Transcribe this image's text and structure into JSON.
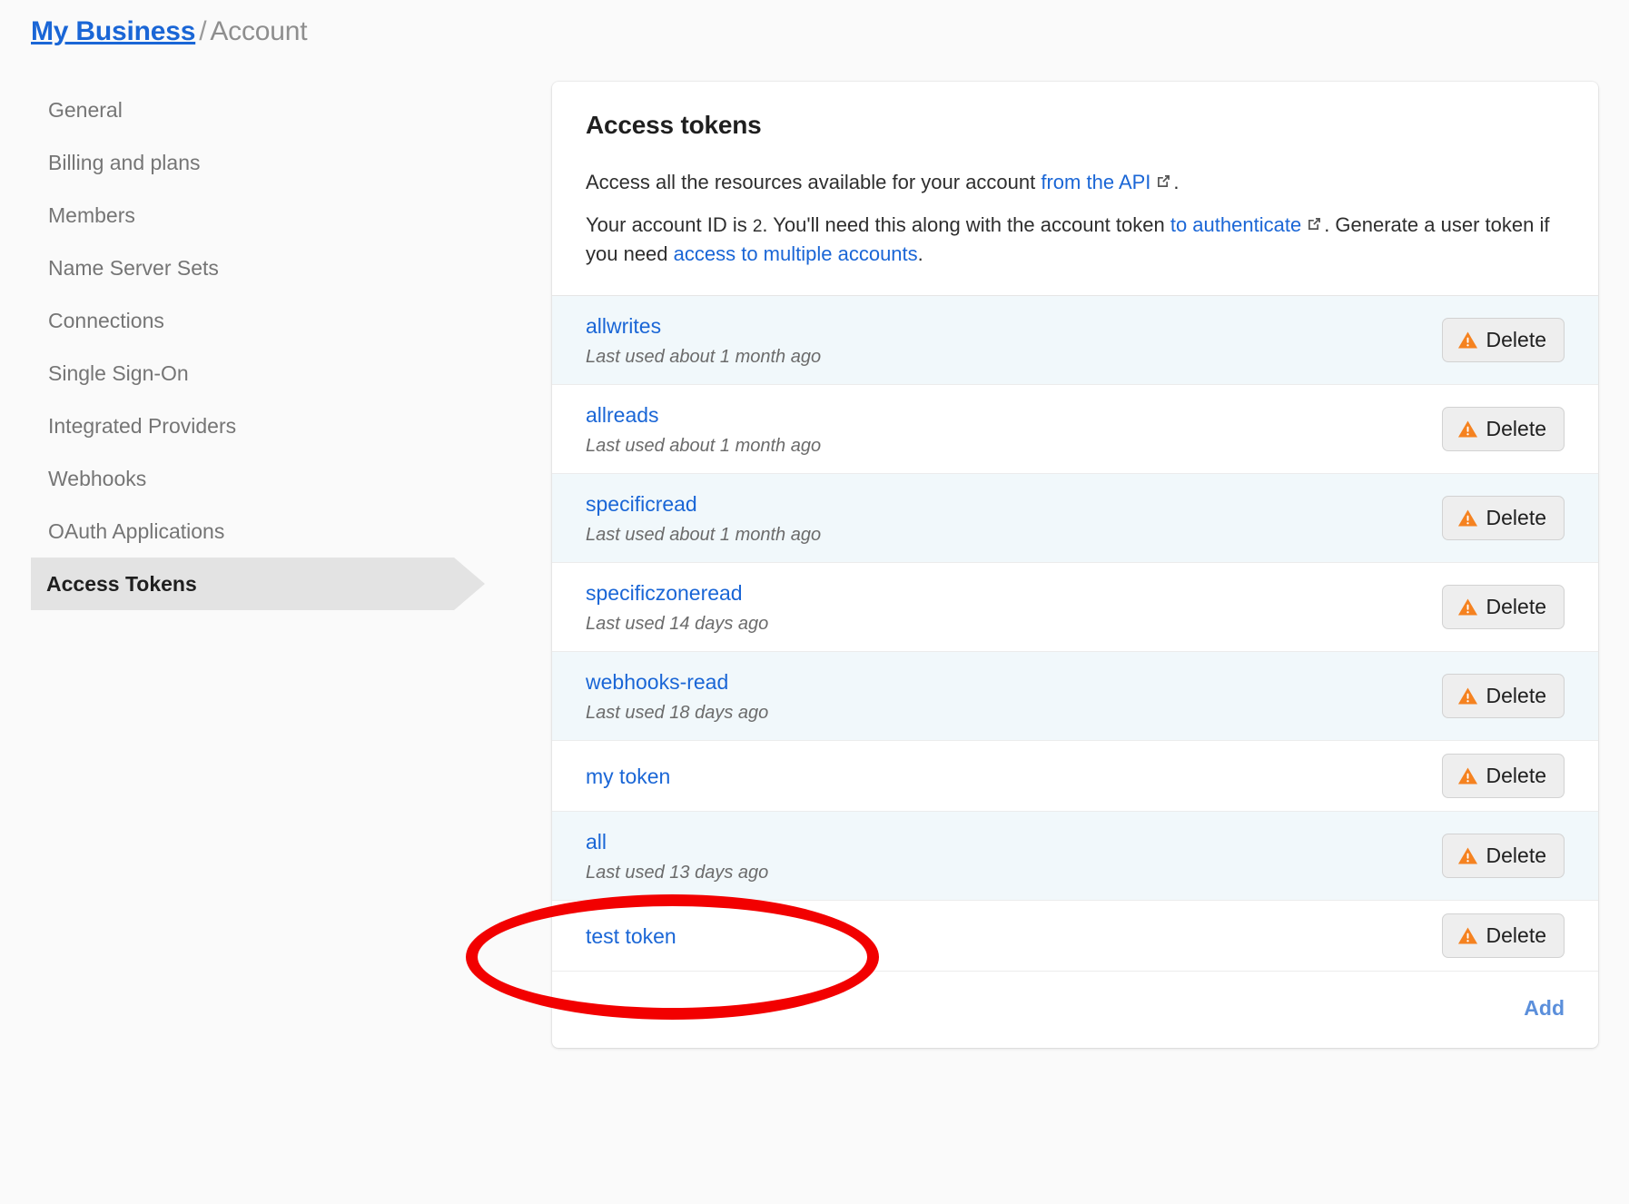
{
  "breadcrumb": {
    "root": "My Business",
    "separator": "/",
    "current": "Account"
  },
  "sidebar": {
    "items": [
      {
        "label": "General",
        "active": false
      },
      {
        "label": "Billing and plans",
        "active": false
      },
      {
        "label": "Members",
        "active": false
      },
      {
        "label": "Name Server Sets",
        "active": false
      },
      {
        "label": "Connections",
        "active": false
      },
      {
        "label": "Single Sign-On",
        "active": false
      },
      {
        "label": "Integrated Providers",
        "active": false
      },
      {
        "label": "Webhooks",
        "active": false
      },
      {
        "label": "OAuth Applications",
        "active": false
      },
      {
        "label": "Access Tokens",
        "active": true
      }
    ]
  },
  "card": {
    "title": "Access tokens",
    "paragraph1": {
      "text_before": "Access all the resources available for your account ",
      "link": "from the API",
      "link_icon": "external-link-icon",
      "text_after": "."
    },
    "paragraph2": {
      "text_before": "Your account ID is ",
      "account_id": "2",
      "text_mid1": ". You'll need this along with the account token ",
      "link1": "to authenticate",
      "link1_icon": "external-link-icon",
      "text_mid2": ". Generate a user token if you need ",
      "link2": "access to multiple accounts",
      "text_after": "."
    },
    "delete_label": "Delete",
    "delete_icon": "warning-triangle-icon",
    "add_label": "Add",
    "tokens": [
      {
        "name": "allwrites",
        "last_used": "Last used about 1 month ago"
      },
      {
        "name": "allreads",
        "last_used": "Last used about 1 month ago"
      },
      {
        "name": "specificread",
        "last_used": "Last used about 1 month ago"
      },
      {
        "name": "specificzoneread",
        "last_used": "Last used 14 days ago"
      },
      {
        "name": "webhooks-read",
        "last_used": "Last used 18 days ago"
      },
      {
        "name": "my token",
        "last_used": ""
      },
      {
        "name": "all",
        "last_used": "Last used 13 days ago"
      },
      {
        "name": "test token",
        "last_used": ""
      }
    ]
  },
  "annotation": {
    "shape": "ellipse",
    "color": "#f20000",
    "target": "all"
  },
  "colors": {
    "link_blue": "#1a66d6",
    "add_blue": "#5b8fdb",
    "warning_orange": "#f58220",
    "row_tint": "#f1f8fb",
    "active_nav": "#e3e3e3",
    "page_bg": "#fafafa"
  }
}
